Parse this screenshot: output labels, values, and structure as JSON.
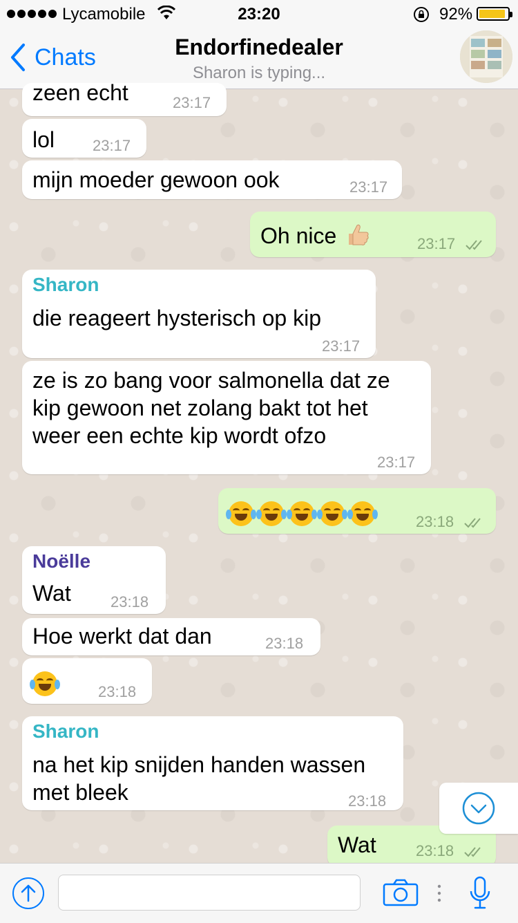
{
  "status_bar": {
    "carrier": "Lycamobile",
    "time": "23:20",
    "battery": "92%",
    "battery_level": 0.92
  },
  "header": {
    "back_label": "Chats",
    "title": "Endorfinedealer",
    "subtitle": "Sharon is typing..."
  },
  "messages": [
    {
      "dir": "in",
      "text": "zeen echt",
      "time": "23:17"
    },
    {
      "dir": "in",
      "text": "lol",
      "time": "23:17"
    },
    {
      "dir": "in",
      "text": "mijn moeder gewoon ook",
      "time": "23:17"
    },
    {
      "dir": "out",
      "text": "Oh nice",
      "emoji": "thumbs-up",
      "time": "23:17",
      "read": true
    },
    {
      "dir": "in",
      "sender": "Sharon",
      "sender_color": "#35b6c5",
      "text": "die reageert hysterisch op kip",
      "time": "23:17"
    },
    {
      "dir": "in",
      "text": "ze is zo bang voor salmonella dat ze\nkip gewoon net zolang bakt tot het\nweer een echte kip wordt ofzo",
      "time": "23:17"
    },
    {
      "dir": "out",
      "emoji": "face-with-tears-of-joy",
      "emoji_count": 5,
      "time": "23:18",
      "read": true
    },
    {
      "dir": "in",
      "sender": "Noëlle",
      "sender_color": "#4a3b9a",
      "text": "Wat",
      "time": "23:18"
    },
    {
      "dir": "in",
      "text": "Hoe werkt dat dan",
      "time": "23:18"
    },
    {
      "dir": "in",
      "emoji": "face-with-tears-of-joy",
      "emoji_count": 1,
      "time": "23:18"
    },
    {
      "dir": "in",
      "sender": "Sharon",
      "sender_color": "#35b6c5",
      "text": "na het kip snijden handen wassen\nmet bleek",
      "time": "23:18"
    },
    {
      "dir": "out",
      "text": "Wat",
      "time": "23:18",
      "read": true
    }
  ],
  "input": {
    "placeholder": ""
  },
  "colors": {
    "accent": "#007aff",
    "outgoing_bubble": "#dcf8c6",
    "incoming_bubble": "#ffffff",
    "chat_background": "#e5ddd5"
  }
}
